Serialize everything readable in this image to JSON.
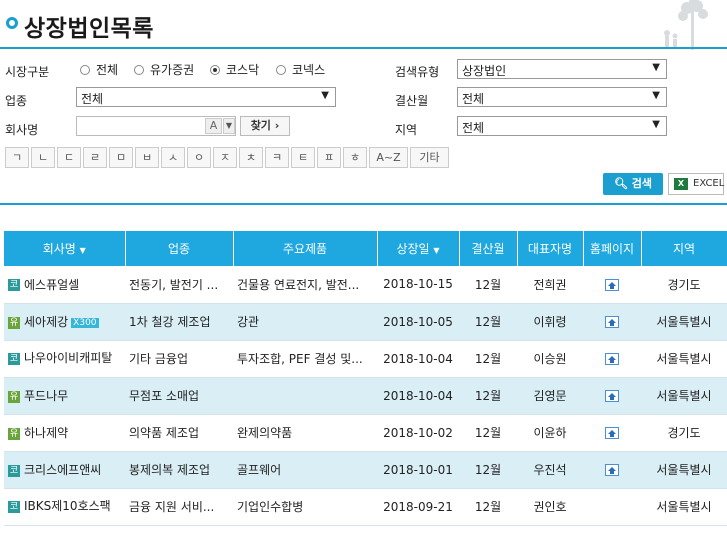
{
  "page": {
    "title": "상장법인목록"
  },
  "filters": {
    "market_label": "시장구분",
    "markets": [
      "전체",
      "유가증권",
      "코스닥",
      "코넥스"
    ],
    "search_type_label": "검색유형",
    "search_type_value": "상장법인",
    "industry_label": "업종",
    "industry_value": "전체",
    "settle_label": "결산월",
    "settle_value": "전체",
    "company_label": "회사명",
    "company_value": "",
    "ab_label": "A",
    "find_label": "찾기",
    "region_label": "지역",
    "region_value": "전체",
    "initials": [
      "ㄱ",
      "ㄴ",
      "ㄷ",
      "ㄹ",
      "ㅁ",
      "ㅂ",
      "ㅅ",
      "ㅇ",
      "ㅈ",
      "ㅊ",
      "ㅋ",
      "ㅌ",
      "ㅍ",
      "ㅎ",
      "A~Z",
      "기타"
    ],
    "search_button": "검색",
    "excel_button": "EXCEL"
  },
  "table": {
    "headers": [
      "회사명",
      "업종",
      "주요제품",
      "상장일",
      "결산월",
      "대표자명",
      "홈페이지",
      "지역"
    ],
    "rows": [
      {
        "market": "코",
        "name": "에스퓨얼셀",
        "tag": "",
        "industry": "전동기, 발전기 ...",
        "product": "건물용 연료전지, 발전...",
        "date": "2018-10-15",
        "month": "12월",
        "ceo": "전희권",
        "home": true,
        "region": "경기도"
      },
      {
        "market": "유",
        "name": "세아제강",
        "tag": "X300",
        "industry": "1차 철강 제조업",
        "product": "강관",
        "date": "2018-10-05",
        "month": "12월",
        "ceo": "이휘령",
        "home": true,
        "region": "서울특별시"
      },
      {
        "market": "코",
        "name": "나우아이비캐피탈",
        "tag": "",
        "industry": "기타 금융업",
        "product": "투자조합, PEF 결성 및...",
        "date": "2018-10-04",
        "month": "12월",
        "ceo": "이승원",
        "home": true,
        "region": "서울특별시"
      },
      {
        "market": "유",
        "name": "푸드나무",
        "tag": "",
        "industry": "무점포 소매업",
        "product": "",
        "date": "2018-10-04",
        "month": "12월",
        "ceo": "김영문",
        "home": true,
        "region": "서울특별시"
      },
      {
        "market": "유",
        "name": "하나제약",
        "tag": "",
        "industry": "의약품 제조업",
        "product": "완제의약품",
        "date": "2018-10-02",
        "month": "12월",
        "ceo": "이윤하",
        "home": true,
        "region": "경기도"
      },
      {
        "market": "코",
        "name": "크리스에프앤씨",
        "tag": "",
        "industry": "봉제의복 제조업",
        "product": "골프웨어",
        "date": "2018-10-01",
        "month": "12월",
        "ceo": "우진석",
        "home": true,
        "region": "서울특별시"
      },
      {
        "market": "코",
        "name": "IBKS제10호스팩",
        "tag": "",
        "industry": "금융 지원 서비...",
        "product": "기업인수합병",
        "date": "2018-09-21",
        "month": "12월",
        "ceo": "권인호",
        "home": false,
        "region": "서울특별시"
      }
    ]
  }
}
